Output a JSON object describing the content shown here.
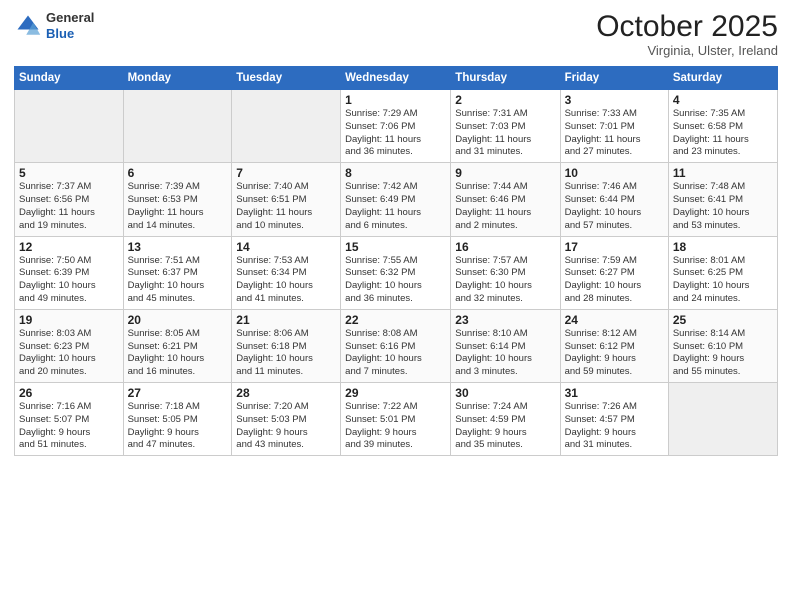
{
  "header": {
    "logo_general": "General",
    "logo_blue": "Blue",
    "month": "October 2025",
    "location": "Virginia, Ulster, Ireland"
  },
  "weekdays": [
    "Sunday",
    "Monday",
    "Tuesday",
    "Wednesday",
    "Thursday",
    "Friday",
    "Saturday"
  ],
  "weeks": [
    [
      {
        "day": "",
        "info": ""
      },
      {
        "day": "",
        "info": ""
      },
      {
        "day": "",
        "info": ""
      },
      {
        "day": "1",
        "info": "Sunrise: 7:29 AM\nSunset: 7:06 PM\nDaylight: 11 hours\nand 36 minutes."
      },
      {
        "day": "2",
        "info": "Sunrise: 7:31 AM\nSunset: 7:03 PM\nDaylight: 11 hours\nand 31 minutes."
      },
      {
        "day": "3",
        "info": "Sunrise: 7:33 AM\nSunset: 7:01 PM\nDaylight: 11 hours\nand 27 minutes."
      },
      {
        "day": "4",
        "info": "Sunrise: 7:35 AM\nSunset: 6:58 PM\nDaylight: 11 hours\nand 23 minutes."
      }
    ],
    [
      {
        "day": "5",
        "info": "Sunrise: 7:37 AM\nSunset: 6:56 PM\nDaylight: 11 hours\nand 19 minutes."
      },
      {
        "day": "6",
        "info": "Sunrise: 7:39 AM\nSunset: 6:53 PM\nDaylight: 11 hours\nand 14 minutes."
      },
      {
        "day": "7",
        "info": "Sunrise: 7:40 AM\nSunset: 6:51 PM\nDaylight: 11 hours\nand 10 minutes."
      },
      {
        "day": "8",
        "info": "Sunrise: 7:42 AM\nSunset: 6:49 PM\nDaylight: 11 hours\nand 6 minutes."
      },
      {
        "day": "9",
        "info": "Sunrise: 7:44 AM\nSunset: 6:46 PM\nDaylight: 11 hours\nand 2 minutes."
      },
      {
        "day": "10",
        "info": "Sunrise: 7:46 AM\nSunset: 6:44 PM\nDaylight: 10 hours\nand 57 minutes."
      },
      {
        "day": "11",
        "info": "Sunrise: 7:48 AM\nSunset: 6:41 PM\nDaylight: 10 hours\nand 53 minutes."
      }
    ],
    [
      {
        "day": "12",
        "info": "Sunrise: 7:50 AM\nSunset: 6:39 PM\nDaylight: 10 hours\nand 49 minutes."
      },
      {
        "day": "13",
        "info": "Sunrise: 7:51 AM\nSunset: 6:37 PM\nDaylight: 10 hours\nand 45 minutes."
      },
      {
        "day": "14",
        "info": "Sunrise: 7:53 AM\nSunset: 6:34 PM\nDaylight: 10 hours\nand 41 minutes."
      },
      {
        "day": "15",
        "info": "Sunrise: 7:55 AM\nSunset: 6:32 PM\nDaylight: 10 hours\nand 36 minutes."
      },
      {
        "day": "16",
        "info": "Sunrise: 7:57 AM\nSunset: 6:30 PM\nDaylight: 10 hours\nand 32 minutes."
      },
      {
        "day": "17",
        "info": "Sunrise: 7:59 AM\nSunset: 6:27 PM\nDaylight: 10 hours\nand 28 minutes."
      },
      {
        "day": "18",
        "info": "Sunrise: 8:01 AM\nSunset: 6:25 PM\nDaylight: 10 hours\nand 24 minutes."
      }
    ],
    [
      {
        "day": "19",
        "info": "Sunrise: 8:03 AM\nSunset: 6:23 PM\nDaylight: 10 hours\nand 20 minutes."
      },
      {
        "day": "20",
        "info": "Sunrise: 8:05 AM\nSunset: 6:21 PM\nDaylight: 10 hours\nand 16 minutes."
      },
      {
        "day": "21",
        "info": "Sunrise: 8:06 AM\nSunset: 6:18 PM\nDaylight: 10 hours\nand 11 minutes."
      },
      {
        "day": "22",
        "info": "Sunrise: 8:08 AM\nSunset: 6:16 PM\nDaylight: 10 hours\nand 7 minutes."
      },
      {
        "day": "23",
        "info": "Sunrise: 8:10 AM\nSunset: 6:14 PM\nDaylight: 10 hours\nand 3 minutes."
      },
      {
        "day": "24",
        "info": "Sunrise: 8:12 AM\nSunset: 6:12 PM\nDaylight: 9 hours\nand 59 minutes."
      },
      {
        "day": "25",
        "info": "Sunrise: 8:14 AM\nSunset: 6:10 PM\nDaylight: 9 hours\nand 55 minutes."
      }
    ],
    [
      {
        "day": "26",
        "info": "Sunrise: 7:16 AM\nSunset: 5:07 PM\nDaylight: 9 hours\nand 51 minutes."
      },
      {
        "day": "27",
        "info": "Sunrise: 7:18 AM\nSunset: 5:05 PM\nDaylight: 9 hours\nand 47 minutes."
      },
      {
        "day": "28",
        "info": "Sunrise: 7:20 AM\nSunset: 5:03 PM\nDaylight: 9 hours\nand 43 minutes."
      },
      {
        "day": "29",
        "info": "Sunrise: 7:22 AM\nSunset: 5:01 PM\nDaylight: 9 hours\nand 39 minutes."
      },
      {
        "day": "30",
        "info": "Sunrise: 7:24 AM\nSunset: 4:59 PM\nDaylight: 9 hours\nand 35 minutes."
      },
      {
        "day": "31",
        "info": "Sunrise: 7:26 AM\nSunset: 4:57 PM\nDaylight: 9 hours\nand 31 minutes."
      },
      {
        "day": "",
        "info": ""
      }
    ]
  ]
}
